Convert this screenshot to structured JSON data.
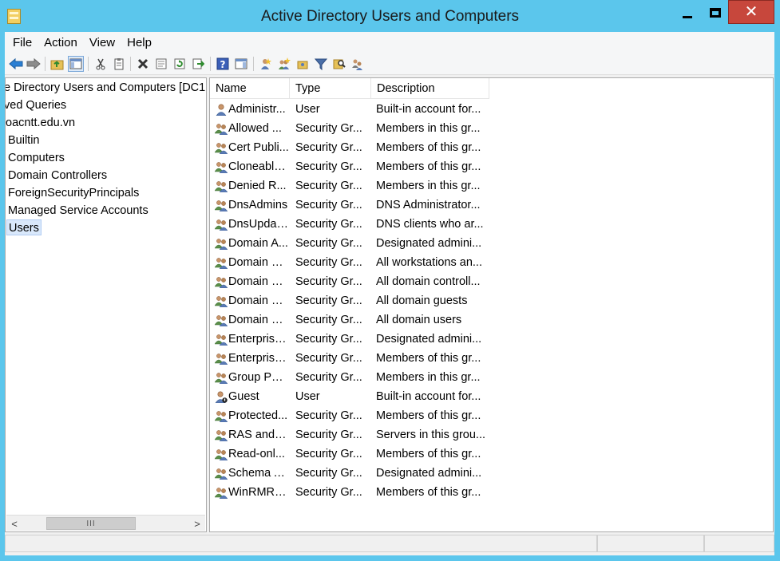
{
  "window": {
    "title": "Active Directory Users and Computers"
  },
  "menu": [
    "File",
    "Action",
    "View",
    "Help"
  ],
  "toolbar": {
    "icons": [
      "back-arrow-icon",
      "forward-arrow-icon",
      "folder-up-icon",
      "show-hide-console-tree-icon",
      "cut-icon",
      "copy-icon",
      "delete-icon",
      "properties-icon",
      "refresh-icon",
      "export-list-icon",
      "help-icon",
      "action-pane-icon",
      "create-user-icon",
      "create-group-icon",
      "filter-icon",
      "create-ou-icon",
      "add-to-group-icon"
    ]
  },
  "tree": {
    "items": [
      {
        "label": "e Directory Users and Computers [DC1",
        "selected": false
      },
      {
        "label": "ved Queries",
        "selected": false
      },
      {
        "label": "oacntt.edu.vn",
        "selected": false
      },
      {
        "label": "Builtin",
        "selected": false
      },
      {
        "label": "Computers",
        "selected": false
      },
      {
        "label": "Domain Controllers",
        "selected": false
      },
      {
        "label": "ForeignSecurityPrincipals",
        "selected": false
      },
      {
        "label": "Managed Service Accounts",
        "selected": false
      },
      {
        "label": "Users",
        "selected": true
      }
    ],
    "scroll_thumb_glyph": "III",
    "scroll_left_glyph": "<",
    "scroll_right_glyph": ">"
  },
  "list": {
    "columns": [
      "Name",
      "Type",
      "Description"
    ],
    "rows": [
      {
        "icon": "user",
        "name": "Administr...",
        "type": "User",
        "description": "Built-in account for..."
      },
      {
        "icon": "group",
        "name": "Allowed ...",
        "type": "Security Gr...",
        "description": "Members in this gr..."
      },
      {
        "icon": "group",
        "name": "Cert Publi...",
        "type": "Security Gr...",
        "description": "Members of this gr..."
      },
      {
        "icon": "group",
        "name": "Cloneable...",
        "type": "Security Gr...",
        "description": "Members of this gr..."
      },
      {
        "icon": "group",
        "name": "Denied R...",
        "type": "Security Gr...",
        "description": "Members in this gr..."
      },
      {
        "icon": "group",
        "name": "DnsAdmins",
        "type": "Security Gr...",
        "description": "DNS Administrator..."
      },
      {
        "icon": "group",
        "name": "DnsUpdat...",
        "type": "Security Gr...",
        "description": "DNS clients who ar..."
      },
      {
        "icon": "group",
        "name": "Domain A...",
        "type": "Security Gr...",
        "description": "Designated admini..."
      },
      {
        "icon": "group",
        "name": "Domain C...",
        "type": "Security Gr...",
        "description": "All workstations an..."
      },
      {
        "icon": "group",
        "name": "Domain C...",
        "type": "Security Gr...",
        "description": "All domain controll..."
      },
      {
        "icon": "group",
        "name": "Domain G...",
        "type": "Security Gr...",
        "description": "All domain guests"
      },
      {
        "icon": "group",
        "name": "Domain U...",
        "type": "Security Gr...",
        "description": "All domain users"
      },
      {
        "icon": "group",
        "name": "Enterprise...",
        "type": "Security Gr...",
        "description": "Designated admini..."
      },
      {
        "icon": "group",
        "name": "Enterprise...",
        "type": "Security Gr...",
        "description": "Members of this gr..."
      },
      {
        "icon": "group",
        "name": "Group Pol...",
        "type": "Security Gr...",
        "description": "Members in this gr..."
      },
      {
        "icon": "user-disabled",
        "name": "Guest",
        "type": "User",
        "description": "Built-in account for..."
      },
      {
        "icon": "group",
        "name": "Protected...",
        "type": "Security Gr...",
        "description": "Members of this gr..."
      },
      {
        "icon": "group",
        "name": "RAS and I...",
        "type": "Security Gr...",
        "description": "Servers in this grou..."
      },
      {
        "icon": "group",
        "name": "Read-onl...",
        "type": "Security Gr...",
        "description": "Members of this gr..."
      },
      {
        "icon": "group",
        "name": "Schema A...",
        "type": "Security Gr...",
        "description": "Designated admini..."
      },
      {
        "icon": "group",
        "name": "WinRMRe...",
        "type": "Security Gr...",
        "description": "Members of this gr..."
      }
    ]
  },
  "colors": {
    "titlebar": "#5bc6ec",
    "close_button": "#c7473c",
    "selection": "#d9e8fb"
  }
}
